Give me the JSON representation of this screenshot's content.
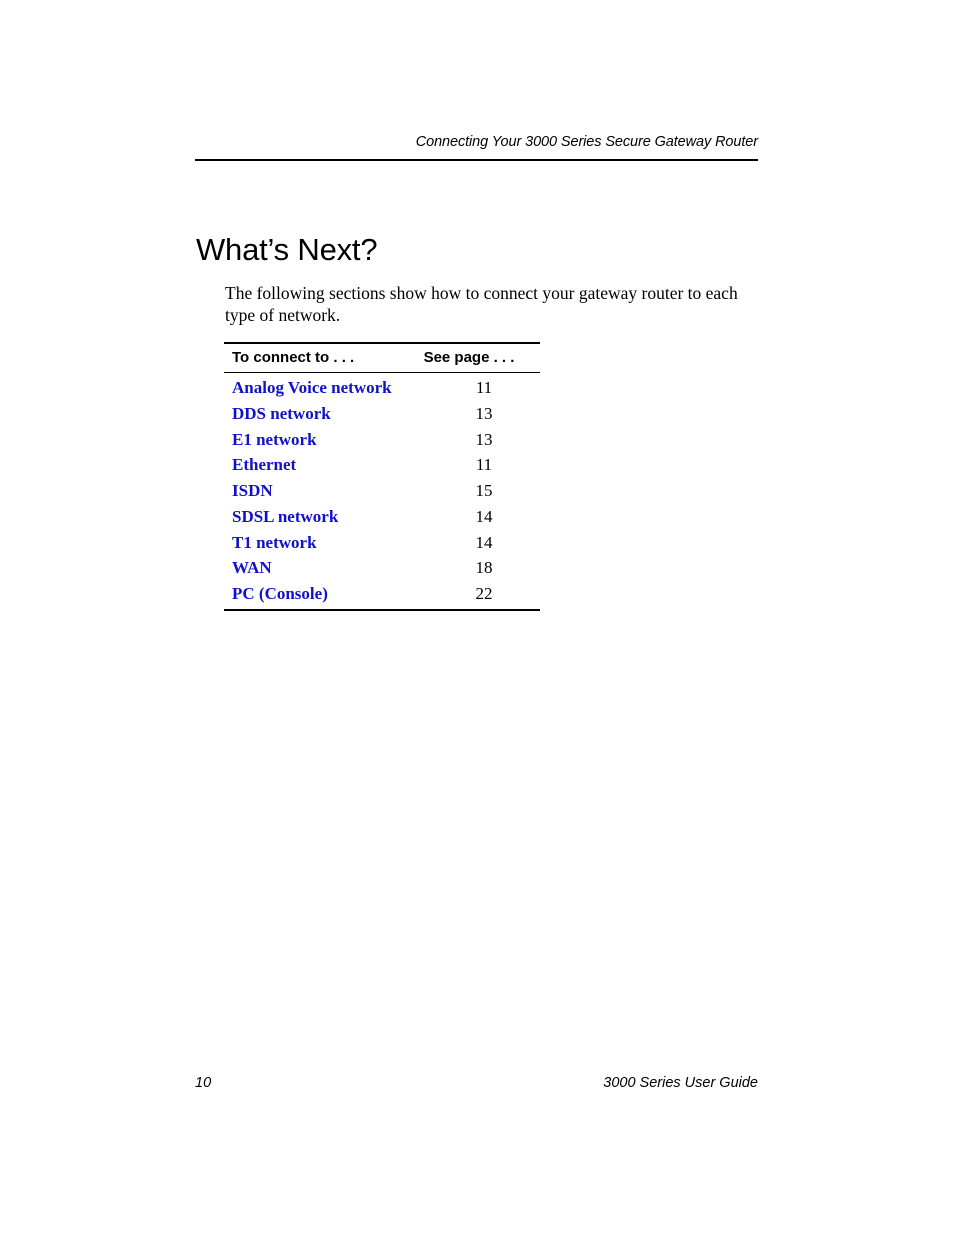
{
  "header": {
    "running_title": "Connecting Your 3000 Series Secure Gateway Router"
  },
  "main": {
    "section_title": "What’s Next?",
    "intro_paragraph": "The following sections show how to connect your gateway router to each type of network.",
    "table": {
      "columns": [
        "To connect to . . .",
        "See page . . ."
      ],
      "rows": [
        {
          "label": "Analog Voice network",
          "page": "11"
        },
        {
          "label": "DDS network",
          "page": "13"
        },
        {
          "label": "E1 network",
          "page": "13"
        },
        {
          "label": "Ethernet",
          "page": "11"
        },
        {
          "label": "ISDN",
          "page": "15"
        },
        {
          "label": "SDSL network",
          "page": "14"
        },
        {
          "label": "T1 network",
          "page": "14"
        },
        {
          "label": "WAN",
          "page": "18"
        },
        {
          "label": "PC (Console)",
          "page": "22"
        }
      ]
    }
  },
  "footer": {
    "page_number": "10",
    "guide_title": "3000 Series User Guide"
  },
  "colors": {
    "link": "#1111CC",
    "text": "#000000",
    "background": "#ffffff"
  }
}
